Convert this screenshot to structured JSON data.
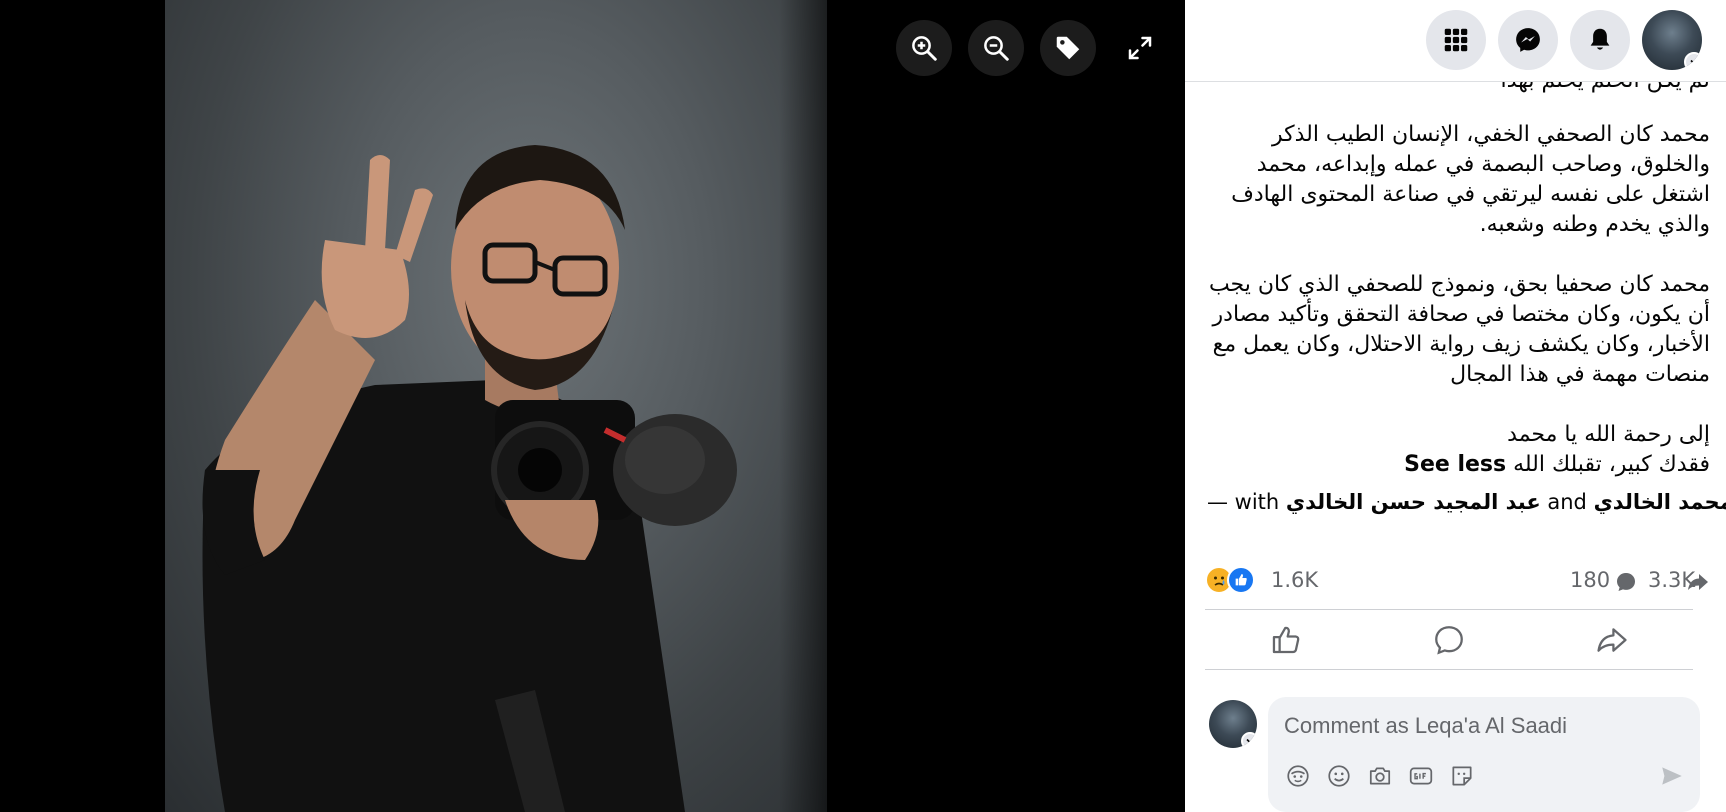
{
  "viewer": {
    "controls": [
      {
        "name": "zoom-in-icon"
      },
      {
        "name": "zoom-out-icon"
      },
      {
        "name": "tag-icon"
      },
      {
        "name": "fullscreen-icon"
      }
    ]
  },
  "topbar": {
    "buttons": [
      "menu-grid-icon",
      "messenger-icon",
      "notifications-bell-icon"
    ],
    "account_badge": "chevron-down-icon"
  },
  "post": {
    "truncated_line": "لم يكن الحلم يحلم بهذا",
    "paragraphs": [
      "محمد كان الصحفي الخفي، الإنسان الطيب الذكر والخلوق، وصاحب البصمة في عمله وإبداعه، محمد اشتغل على نفسه ليرتقي في صناعة المحتوى الهادف والذي يخدم وطنه وشعبه.",
      "محمد كان صحفيا بحق، ونموذج للصحفي الذي كان يجب أن يكون، وكان مختصا في صحافة التحقق وتأكيد مصادر الأخبار، وكان يكشف زيف رواية الاحتلال، وكان يعمل مع منصات مهمة في هذا المجال"
    ],
    "closing_line_1": "إلى رحمة الله يا محمد",
    "closing_line_2": "فقدك كبير، تقبلك الله",
    "see_less": "See less",
    "tags": {
      "prefix": "— with",
      "person_1": "عبد المجيد حسن الخالدي",
      "conjunction": "and",
      "person_2": "محمد الخالدي",
      "suffix": "."
    }
  },
  "reactions": {
    "icons": [
      "sad-reaction-icon",
      "like-reaction-icon"
    ],
    "count": "1.6K",
    "comments": "180",
    "shares": "3.3K"
  },
  "actions": [
    "like-icon",
    "comment-icon",
    "share-icon"
  ],
  "comment_box": {
    "placeholder": "Comment as Leqa'a Al Saadi",
    "tools": [
      "avatar-sticker-icon",
      "emoji-icon",
      "camera-icon",
      "gif-icon",
      "sticker-icon"
    ],
    "send": "send-icon"
  },
  "colors": {
    "accent": "#1877f2",
    "sad_yellow": "#f7b125",
    "secondary_text": "#65676b",
    "button_bg": "#e4e6eb"
  }
}
